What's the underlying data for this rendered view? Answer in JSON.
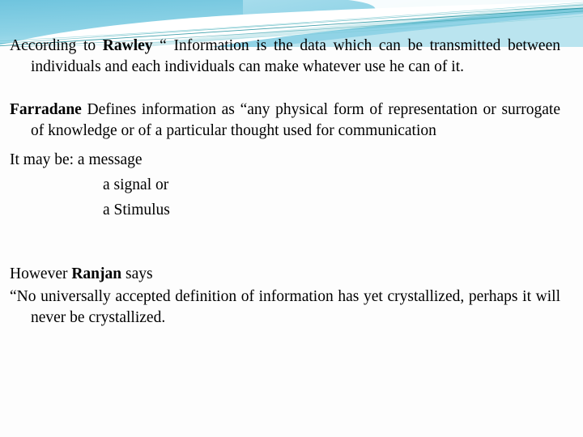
{
  "slide": {
    "background_color": "#fdfdfd",
    "text_color": "#000000"
  },
  "header_decoration": {
    "name": "wave-banner",
    "colors": {
      "sky_blue": "#74c7e0",
      "light_blue": "#a8dcea",
      "pale_cyan": "#c9ecf3",
      "teal_line": "#1f8f9c",
      "teal_mid": "#3aa8b4",
      "white": "#ffffff"
    }
  },
  "content": {
    "paragraph_rawley": {
      "lead": "According to ",
      "author": "Rawley",
      "quote": " “ Information is the data which can be transmitted between individuals and each individuals can make whatever use he can of it."
    },
    "paragraph_farradane": {
      "author": "Farradane",
      "quote": " Defines information as “any physical form of representation or surrogate of knowledge or of a particular thought used for communication"
    },
    "list_intro": "It may be: a message",
    "list_items": [
      "a signal or",
      "a Stimulus"
    ],
    "paragraph_ranjan": {
      "lead": "However ",
      "author": "Ranjan",
      "trail": " says"
    },
    "paragraph_ranjan_quote": "“No universally accepted definition of information has yet crystallized, perhaps it will never be crystallized."
  }
}
